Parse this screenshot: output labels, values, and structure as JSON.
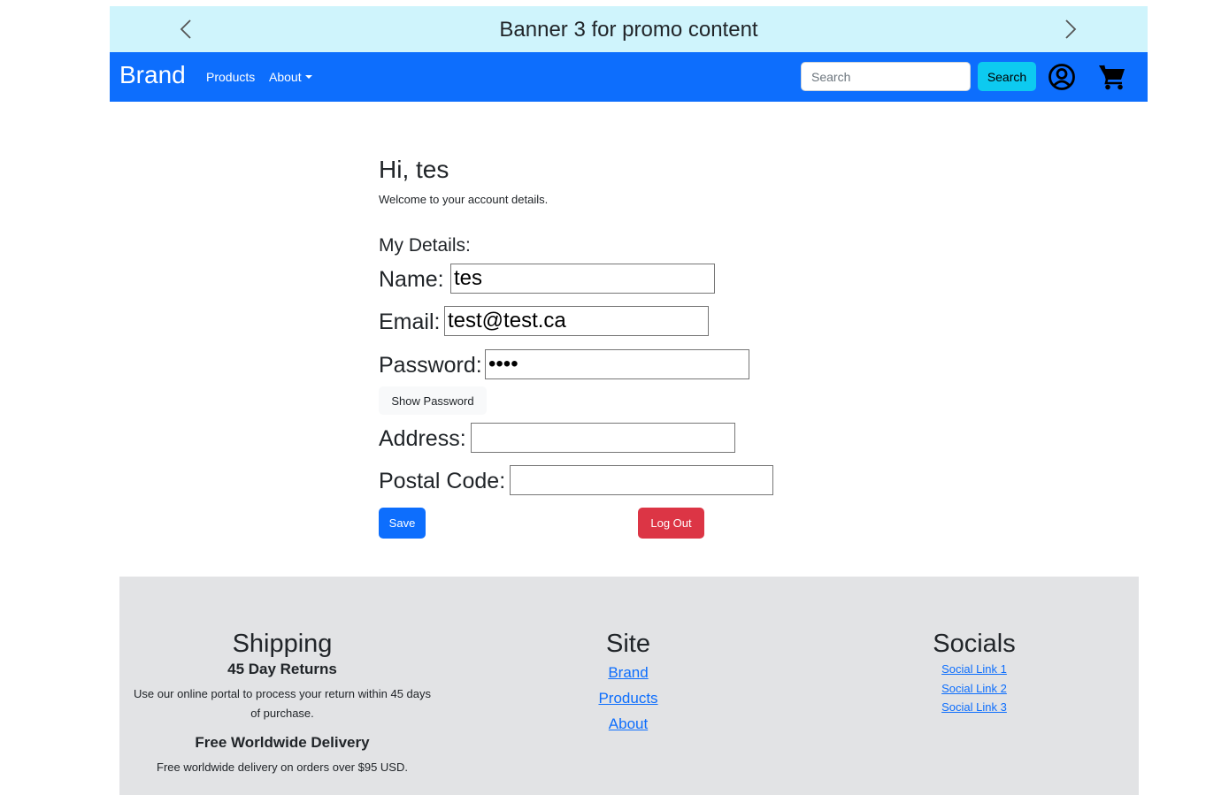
{
  "banner": {
    "text": "Banner 3 for promo content",
    "prev_icon": "chevron-left-icon",
    "next_icon": "chevron-right-icon"
  },
  "navbar": {
    "brand": "Brand",
    "products": "Products",
    "about": "About",
    "search_placeholder": "Search",
    "search_button": "Search",
    "account_icon": "user-circle-icon",
    "cart_icon": "shopping-cart-icon",
    "color": "#0d6efd"
  },
  "account": {
    "greeting": "Hi, tes",
    "welcome": "Welcome to your account details.",
    "details_heading": "My Details:",
    "name_label": "Name:",
    "name_value": "tes",
    "email_label": "Email:",
    "email_value": "test@test.ca",
    "password_label": "Password:",
    "password_value": "test",
    "show_password": "Show Password",
    "address_label": "Address:",
    "address_value": "",
    "postal_label": "Postal Code:",
    "postal_value": "",
    "save": "Save",
    "logout": "Log Out"
  },
  "footer": {
    "shipping": {
      "heading": "Shipping",
      "returns_title": "45 Day Returns",
      "returns_text": "Use our online portal to process your return within 45 days of purchase.",
      "delivery_title": "Free Worldwide Delivery",
      "delivery_text": "Free worldwide delivery on orders over $95 USD."
    },
    "site": {
      "heading": "Site",
      "links": [
        "Brand",
        "Products",
        "About"
      ]
    },
    "socials": {
      "heading": "Socials",
      "links": [
        "Social Link 1",
        "Social Link 2",
        "Social Link 3"
      ]
    }
  }
}
